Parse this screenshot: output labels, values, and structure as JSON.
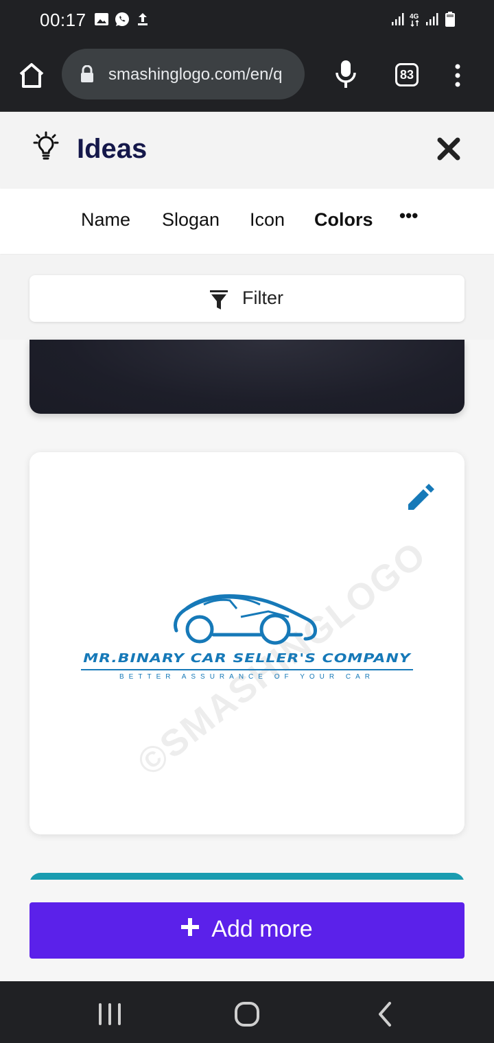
{
  "status_bar": {
    "time": "00:17",
    "icons": [
      "image-icon",
      "whatsapp-icon",
      "upload-icon",
      "signal-icon",
      "network-4g-icon",
      "signal-icon",
      "battery-icon"
    ]
  },
  "browser": {
    "url": "smashinglogo.com/en/q",
    "tab_count": "83",
    "icons": [
      "home-icon",
      "lock-icon",
      "microphone-icon",
      "tabs-icon",
      "more-vertical-icon"
    ]
  },
  "header": {
    "title": "Ideas",
    "icons": [
      "lightbulb-icon",
      "close-icon"
    ]
  },
  "tabs": [
    {
      "label": "Name",
      "active": false
    },
    {
      "label": "Slogan",
      "active": false
    },
    {
      "label": "Icon",
      "active": false
    },
    {
      "label": "Colors",
      "active": true
    },
    {
      "label": "•••",
      "active": false
    }
  ],
  "filter": {
    "label": "Filter",
    "icon": "funnel-icon"
  },
  "logo_card": {
    "company_name": "MR.BINARY CAR SELLER'S COMPANY",
    "slogan": "BETTER ASSURANCE OF YOUR CAR",
    "watermark": "©SMASHINGLOGO",
    "logo_color": "#1679b8",
    "icons": [
      "pencil-icon",
      "car-icon"
    ]
  },
  "cards": {
    "dark_card_color": "#1d1e29",
    "teal_card_color": "#1a9cb0"
  },
  "add_more": {
    "label": "Add more",
    "color": "#5b21ea",
    "icon": "plus-icon"
  },
  "nav_bar": {
    "icons": [
      "recent-apps-icon",
      "home-circle-icon",
      "back-icon"
    ]
  }
}
